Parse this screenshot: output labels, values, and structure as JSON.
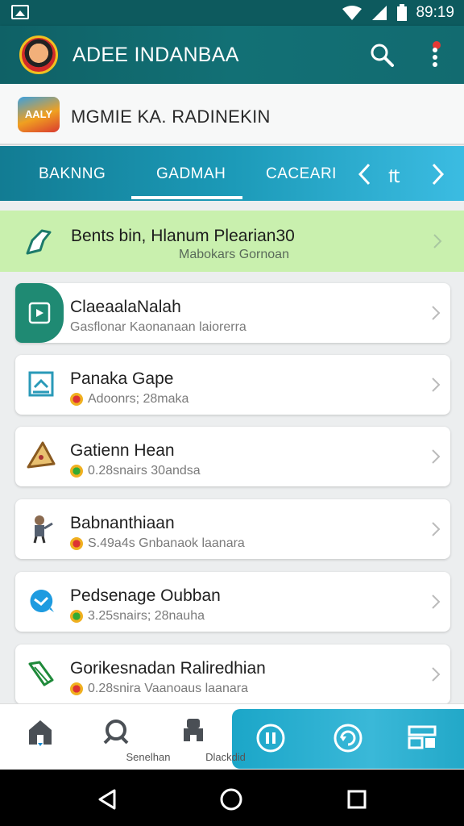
{
  "status_bar": {
    "time": "89:19"
  },
  "app_bar": {
    "title": "ADEE INDANBAA"
  },
  "banner": {
    "text": "MGMIE KA. RADINEKIN",
    "logo_text": "AALY"
  },
  "tabs": [
    {
      "label": "BAKNNG",
      "active": false
    },
    {
      "label": "GADMAH",
      "active": true
    },
    {
      "label": "CACEARI",
      "active": false
    }
  ],
  "tab_nav": {
    "center_label": "₶"
  },
  "promo": {
    "title": "Bents bin, Hlanum Plearian30",
    "subtitle": "Mabokars Gornoan"
  },
  "list": [
    {
      "name": "ClaeaalaNalah",
      "subtitle": "Gasflonar Kaonanaan laiorerra",
      "icon": "photo-app-icon"
    },
    {
      "name": "Panaka Gape",
      "subtitle": "Adoonrs; 28maka",
      "icon": "canvas-icon"
    },
    {
      "name": "Gatienn Hean",
      "subtitle": "0.28snairs 30andsa",
      "icon": "pizza-icon"
    },
    {
      "name": "Babnanthiaan",
      "subtitle": "S.49a4s Gnbanaok laanara",
      "icon": "character-icon"
    },
    {
      "name": "Pedsenage Oubban",
      "subtitle": "3.25snairs; 28nauha",
      "icon": "chat-bubble-icon"
    },
    {
      "name": "Gorikesnadan Raliredhian",
      "subtitle": "0.28snira Vaanoaus laanara",
      "icon": "leaf-icon"
    }
  ],
  "bottom_nav": [
    {
      "label": "",
      "icon": "home-icon"
    },
    {
      "label": "Senelhan",
      "icon": "search-icon"
    },
    {
      "label": "Dlackdid",
      "icon": "robot-icon"
    },
    {
      "label": "",
      "icon": "pause-icon"
    },
    {
      "label": "",
      "icon": "refresh-icon"
    },
    {
      "label": "",
      "icon": "layout-icon"
    }
  ],
  "colors": {
    "app_bar": "#0f6166",
    "tab_bar": "#1c9ab8",
    "promo_bg": "#c9f0ae",
    "accent_green": "#1f8a73"
  }
}
